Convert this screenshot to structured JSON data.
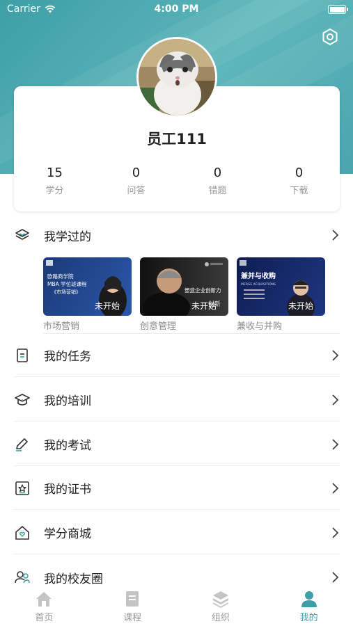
{
  "status_bar": {
    "carrier": "Carrier",
    "time": "4:00 PM"
  },
  "theme": {
    "accent": "#3e9fa6",
    "header": "#4aa5ad"
  },
  "profile": {
    "username": "员工111",
    "stats": [
      {
        "value": "15",
        "label": "学分"
      },
      {
        "value": "0",
        "label": "问答"
      },
      {
        "value": "0",
        "label": "错题"
      },
      {
        "value": "0",
        "label": "下载"
      }
    ]
  },
  "learned": {
    "title": "我学过的",
    "courses": [
      {
        "name": "市场营销",
        "status": "未开始",
        "thumb_lines": [
          "欧路商学院",
          "MBA 学位班课程",
          "《市场营销》"
        ]
      },
      {
        "name": "创意管理",
        "status": "未开始",
        "thumb_lines": [
          "塑造企业创新力",
          "· 创新"
        ]
      },
      {
        "name": "兼收与并购",
        "status": "未开始",
        "thumb_lines": [
          "兼并与收购",
          "MERGE ACQUISITIONS"
        ]
      }
    ]
  },
  "menu": [
    {
      "label": "我的任务",
      "icon": "task-icon"
    },
    {
      "label": "我的培训",
      "icon": "graduation-cap-icon"
    },
    {
      "label": "我的考试",
      "icon": "pencil-icon"
    },
    {
      "label": "我的证书",
      "icon": "certificate-icon"
    },
    {
      "label": "学分商城",
      "icon": "home-heart-icon"
    },
    {
      "label": "我的校友圈",
      "icon": "people-icon"
    }
  ],
  "tabs": [
    {
      "label": "首页",
      "icon": "home-icon"
    },
    {
      "label": "课程",
      "icon": "book-icon"
    },
    {
      "label": "组织",
      "icon": "layers-icon"
    },
    {
      "label": "我的",
      "icon": "user-icon"
    }
  ]
}
